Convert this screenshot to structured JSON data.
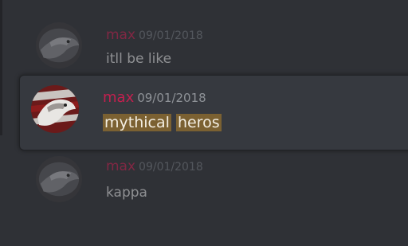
{
  "colors": {
    "background": "#2f3136",
    "username": "#c3204f",
    "timestamp": "#72767d",
    "message_text": "#dcddde",
    "search_highlight": "#7b6132"
  },
  "messages": [
    {
      "author": "max",
      "timestamp": "09/01/2018",
      "text": "itll be like",
      "avatar_icon": "hawk-avatar"
    },
    {
      "author": "max",
      "timestamp": "09/01/2018",
      "words": [
        "mythical",
        "heros"
      ],
      "highlighted": true,
      "avatar_icon": "hawk-avatar"
    },
    {
      "author": "max",
      "timestamp": "09/01/2018",
      "text": "kappa",
      "avatar_icon": "hawk-avatar"
    }
  ]
}
